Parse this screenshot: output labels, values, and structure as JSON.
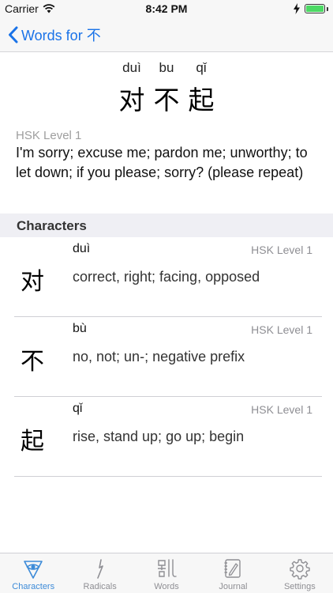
{
  "status_bar": {
    "carrier": "Carrier",
    "time": "8:42 PM",
    "battery_level": 1.0
  },
  "nav": {
    "back_label": "Words for 不"
  },
  "word": {
    "pinyin": [
      "duì",
      "bu",
      "qǐ"
    ],
    "hanzi": [
      "对",
      "不",
      "起"
    ],
    "hsk_level": "HSK Level 1",
    "definition": "I'm sorry; excuse me; pardon me; unworthy; to let down; if you please; sorry? (please repeat)"
  },
  "characters_section": {
    "title": "Characters",
    "items": [
      {
        "hanzi": "对",
        "pinyin": "duì",
        "hsk": "HSK Level 1",
        "meaning": "correct, right; facing, opposed"
      },
      {
        "hanzi": "不",
        "pinyin": "bù",
        "hsk": "HSK Level 1",
        "meaning": "no, not; un-; negative prefix"
      },
      {
        "hanzi": "起",
        "pinyin": "qǐ",
        "hsk": "HSK Level 1",
        "meaning": "rise, stand up; go up; begin"
      }
    ]
  },
  "tab_bar": {
    "items": [
      {
        "label": "Characters",
        "icon": "eye-icon",
        "active": true
      },
      {
        "label": "Radicals",
        "icon": "radical-stroke-icon",
        "active": false
      },
      {
        "label": "Words",
        "icon": "words-glyph-icon",
        "active": false
      },
      {
        "label": "Journal",
        "icon": "journal-icon",
        "active": false
      },
      {
        "label": "Settings",
        "icon": "gear-icon",
        "active": false
      }
    ]
  },
  "colors": {
    "accent": "#1a73e8",
    "tab_active": "#3d8bd8",
    "tab_inactive": "#8e8e93",
    "battery": "#4cd964"
  }
}
